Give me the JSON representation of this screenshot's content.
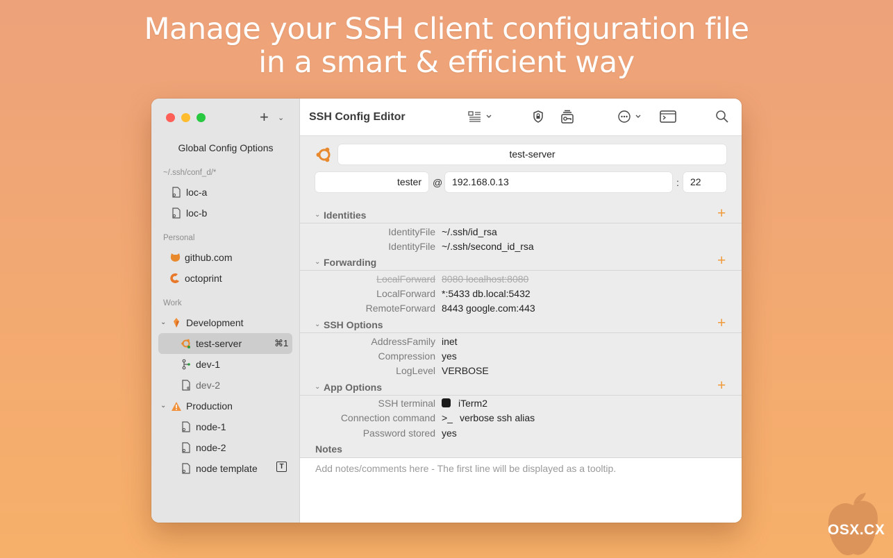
{
  "headline": {
    "line1": "Manage your SSH client configuration file",
    "line2": "in a smart & efficient way"
  },
  "sidebar": {
    "add_icon": "plus-icon",
    "global_options": "Global Config Options",
    "sections": [
      {
        "label": "~/.ssh/conf_d/*",
        "items": [
          {
            "label": "loc-a",
            "icon": "file-icon"
          },
          {
            "label": "loc-b",
            "icon": "file-icon"
          }
        ]
      },
      {
        "label": "Personal",
        "items": [
          {
            "label": "github.com",
            "icon": "github-icon"
          },
          {
            "label": "octoprint",
            "icon": "octoprint-icon"
          }
        ]
      },
      {
        "label": "Work",
        "items": [
          {
            "label": "Development",
            "icon": "gitlab-icon"
          },
          {
            "label": "test-server",
            "icon": "ubuntu-icon",
            "shortcut": "⌘1"
          },
          {
            "label": "dev-1",
            "icon": "git-icon"
          },
          {
            "label": "dev-2",
            "icon": "file-icon"
          },
          {
            "label": "Production",
            "icon": "warning-icon"
          },
          {
            "label": "node-1",
            "icon": "file-icon"
          },
          {
            "label": "node-2",
            "icon": "file-icon"
          },
          {
            "label": "node template",
            "icon": "file-icon",
            "badge": "T"
          }
        ]
      }
    ]
  },
  "toolbar": {
    "title": "SSH Config Editor"
  },
  "host": {
    "name": "test-server",
    "user": "tester",
    "at": "@",
    "hostname": "192.168.0.13",
    "colon": ":",
    "port": "22"
  },
  "sections": {
    "identities": {
      "title": "Identities",
      "rows": [
        {
          "key": "IdentityFile",
          "value": "~/.ssh/id_rsa"
        },
        {
          "key": "IdentityFile",
          "value": "~/.ssh/second_id_rsa"
        }
      ]
    },
    "forwarding": {
      "title": "Forwarding",
      "rows": [
        {
          "key": "LocalForward",
          "value": "8080 localhost:8080",
          "disabled": true
        },
        {
          "key": "LocalForward",
          "value": "*:5433 db.local:5432"
        },
        {
          "key": "RemoteForward",
          "value": "8443 google.com:443"
        }
      ]
    },
    "ssh_options": {
      "title": "SSH Options",
      "rows": [
        {
          "key": "AddressFamily",
          "value": "inet"
        },
        {
          "key": "Compression",
          "value": "yes"
        },
        {
          "key": "LogLevel",
          "value": "VERBOSE"
        }
      ]
    },
    "app_options": {
      "title": "App Options",
      "rows": [
        {
          "key": "SSH terminal",
          "value": "iTerm2"
        },
        {
          "key": "Connection command",
          "value": "verbose ssh alias",
          "prefix": ">_"
        },
        {
          "key": "Password stored",
          "value": "yes"
        }
      ]
    }
  },
  "notes": {
    "title": "Notes",
    "placeholder": "Add notes/comments here - The first line will be displayed as a tooltip."
  },
  "watermark": {
    "text": "OSX.CX"
  },
  "colors": {
    "accent": "#f09a3a",
    "background_top": "#eda27a",
    "background_bottom": "#f7b06a"
  }
}
